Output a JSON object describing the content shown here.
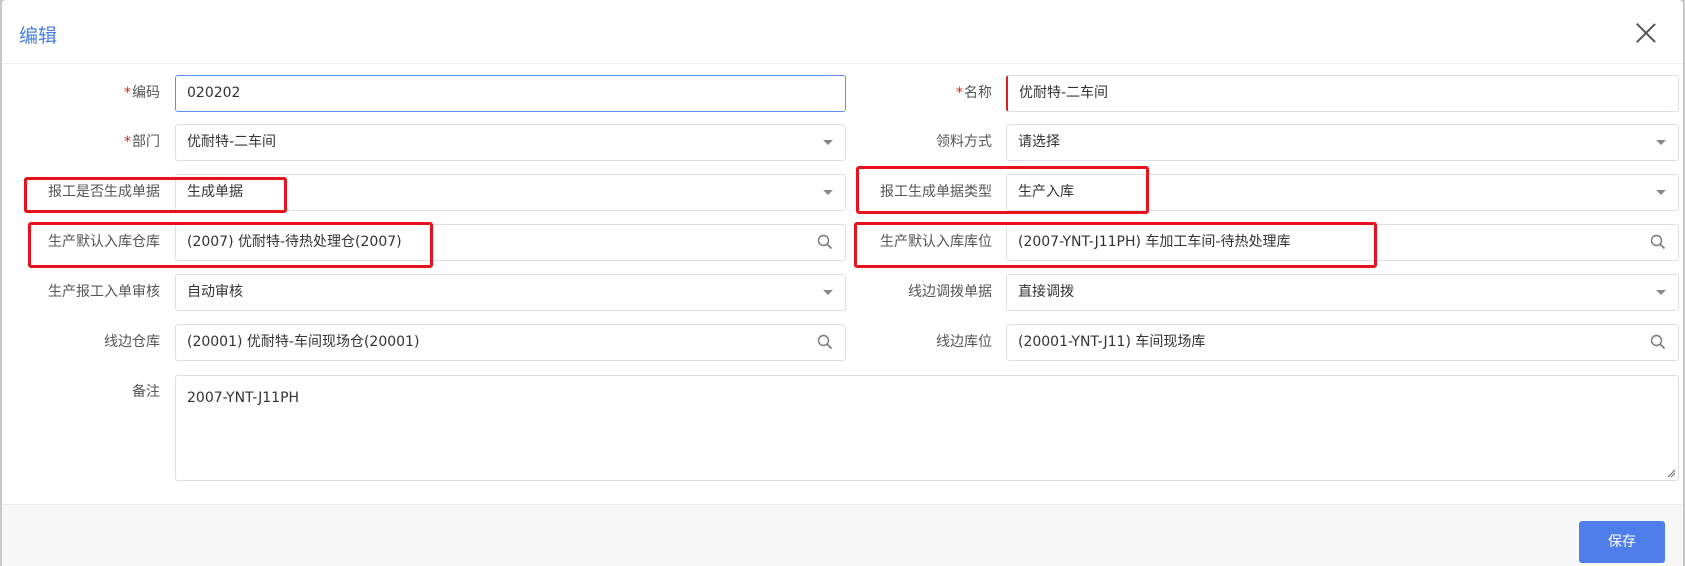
{
  "dialog": {
    "title": "编辑",
    "save_label": "保存"
  },
  "form": {
    "code": {
      "label": "编码",
      "value": "020202",
      "required": "*"
    },
    "name": {
      "label": "名称",
      "value": "优耐特-二车间",
      "required": "*"
    },
    "department": {
      "label": "部门",
      "value": "优耐特-二车间",
      "required": "*"
    },
    "material_method": {
      "label": "领料方式",
      "value": "请选择"
    },
    "report_generate_doc": {
      "label": "报工是否生成单据",
      "value": "生成单据"
    },
    "report_doc_type": {
      "label": "报工生成单据类型",
      "value": "生产入库"
    },
    "default_warehouse": {
      "label": "生产默认入库仓库",
      "value": "(2007) 优耐特-待热处理仓(2007)"
    },
    "default_location": {
      "label": "生产默认入库库位",
      "value": "(2007-YNT-J11PH) 车加工车间-待热处理库"
    },
    "report_inbound_review": {
      "label": "生产报工入单审核",
      "value": "自动审核"
    },
    "line_transfer_doc": {
      "label": "线边调拨单据",
      "value": "直接调拨"
    },
    "line_warehouse": {
      "label": "线边仓库",
      "value": "(20001) 优耐特-车间现场仓(20001)"
    },
    "line_location": {
      "label": "线边库位",
      "value": "(20001-YNT-J11) 车间现场库"
    },
    "remark": {
      "label": "备注",
      "value": "2007-YNT-J11PH"
    }
  },
  "colors": {
    "accent": "#4f7eea",
    "title": "#4a7fe6",
    "highlight": "#e8131a",
    "required": "#e02020"
  }
}
